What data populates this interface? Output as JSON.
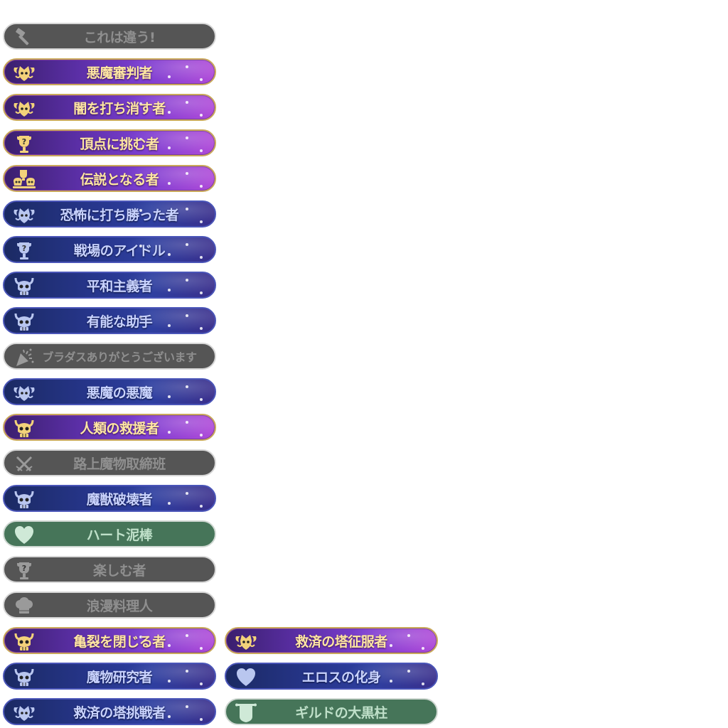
{
  "titles_col1": [
    {
      "label": "これは違う!",
      "style": "grey",
      "icon": "hammer-icon"
    },
    {
      "label": "悪魔審判者",
      "style": "purple",
      "icon": "demon-crest-icon"
    },
    {
      "label": "闇を打ち消す者",
      "style": "purple",
      "icon": "demon-crest-icon"
    },
    {
      "label": "頂点に挑む者",
      "style": "purple",
      "icon": "trophy-question-icon"
    },
    {
      "label": "伝説となる者",
      "style": "purple",
      "icon": "trophy-skull-icon"
    },
    {
      "label": "恐怖に打ち勝った者",
      "style": "blue",
      "icon": "demon-crest-icon"
    },
    {
      "label": "戦場のアイドル",
      "style": "blue",
      "icon": "trophy-question-icon"
    },
    {
      "label": "平和主義者",
      "style": "blue",
      "icon": "horned-skull-icon"
    },
    {
      "label": "有能な助手",
      "style": "blue",
      "icon": "horned-skull-icon"
    },
    {
      "label": "ブラダスありがとうございます",
      "style": "grey",
      "icon": "party-popper-icon",
      "small": true
    },
    {
      "label": "悪魔の悪魔",
      "style": "blue",
      "icon": "demon-crest-icon"
    },
    {
      "label": "人類の救援者",
      "style": "purple",
      "icon": "horned-skull-icon"
    },
    {
      "label": "路上魔物取締班",
      "style": "grey",
      "icon": "crossed-swords-icon"
    },
    {
      "label": "魔獣破壊者",
      "style": "blue",
      "icon": "horned-skull-icon"
    },
    {
      "label": "ハート泥棒",
      "style": "green",
      "icon": "heart-icon"
    },
    {
      "label": "楽しむ者",
      "style": "grey",
      "icon": "trophy-question-icon"
    },
    {
      "label": "浪漫料理人",
      "style": "grey",
      "icon": "chef-hat-icon"
    },
    {
      "label": "亀裂を閉じる者",
      "style": "purple",
      "icon": "horned-skull-icon"
    },
    {
      "label": "魔物研究者",
      "style": "blue",
      "icon": "horned-skull-icon"
    },
    {
      "label": "救済の塔挑戦者",
      "style": "blue",
      "icon": "demon-crest-icon"
    }
  ],
  "titles_col2": [
    {
      "label": "救済の塔征服者",
      "style": "purple",
      "icon": "demon-crest-icon"
    },
    {
      "label": "エロスの化身",
      "style": "blue",
      "icon": "heart-icon"
    },
    {
      "label": "ギルドの大黒柱",
      "style": "green",
      "icon": "banner-icon"
    }
  ]
}
